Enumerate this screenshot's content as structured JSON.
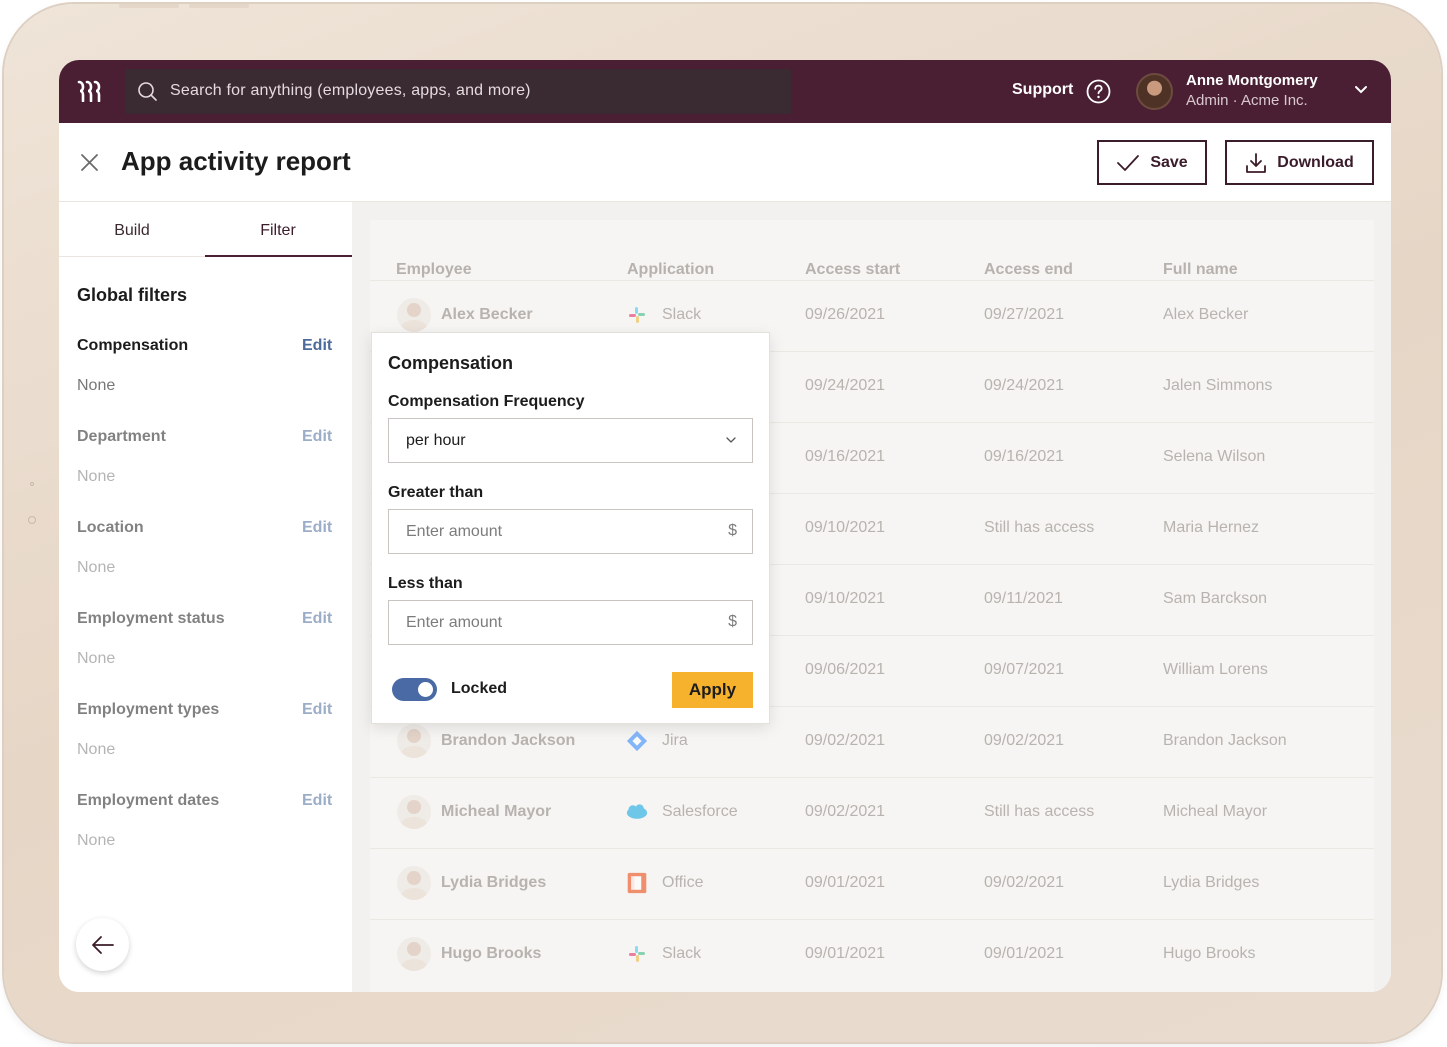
{
  "topbar": {
    "search_placeholder": "Search for anything (employees, apps, and more)",
    "support_label": "Support",
    "user_name": "Anne Montgomery",
    "user_role": "Admin · Acme Inc."
  },
  "header": {
    "title": "App activity report",
    "save_label": "Save",
    "download_label": "Download"
  },
  "sidebar": {
    "tabs": [
      {
        "label": "Build",
        "active": false
      },
      {
        "label": "Filter",
        "active": true
      }
    ],
    "section_title": "Global filters",
    "edit_label": "Edit",
    "filters": [
      {
        "label": "Compensation",
        "value": "None"
      },
      {
        "label": "Department",
        "value": "None"
      },
      {
        "label": "Location",
        "value": "None"
      },
      {
        "label": "Employment status",
        "value": "None"
      },
      {
        "label": "Employment types",
        "value": "None"
      },
      {
        "label": "Employment dates",
        "value": "None"
      }
    ]
  },
  "table": {
    "columns": [
      "Employee",
      "Application",
      "Access start",
      "Access end",
      "Full name"
    ],
    "rows": [
      {
        "employee": "Alex Becker",
        "app": "Slack",
        "icon": "slack-icon",
        "start": "09/26/2021",
        "end": "09/27/2021",
        "full": "Alex Becker"
      },
      {
        "employee": "",
        "app": "",
        "icon": "",
        "start": "09/24/2021",
        "end": "09/24/2021",
        "full": "Jalen Simmons"
      },
      {
        "employee": "",
        "app": "",
        "icon": "",
        "start": "09/16/2021",
        "end": "09/16/2021",
        "full": "Selena Wilson"
      },
      {
        "employee": "",
        "app": "",
        "icon": "",
        "start": "09/10/2021",
        "end": "Still has access",
        "full": "Maria Hernez"
      },
      {
        "employee": "",
        "app": "",
        "icon": "",
        "start": "09/10/2021",
        "end": "09/11/2021",
        "full": "Sam Barckson"
      },
      {
        "employee": "",
        "app": "",
        "icon": "",
        "start": "09/06/2021",
        "end": "09/07/2021",
        "full": "William Lorens"
      },
      {
        "employee": "Brandon Jackson",
        "app": "Jira",
        "icon": "jira-icon",
        "start": "09/02/2021",
        "end": "09/02/2021",
        "full": "Brandon Jackson"
      },
      {
        "employee": "Micheal Mayor",
        "app": "Salesforce",
        "icon": "salesforce-icon",
        "start": "09/02/2021",
        "end": "Still has access",
        "full": "Micheal Mayor"
      },
      {
        "employee": "Lydia Bridges",
        "app": "Office",
        "icon": "office-icon",
        "start": "09/01/2021",
        "end": "09/02/2021",
        "full": "Lydia Bridges"
      },
      {
        "employee": "Hugo Brooks",
        "app": "Slack",
        "icon": "slack-icon",
        "start": "09/01/2021",
        "end": "09/01/2021",
        "full": "Hugo Brooks"
      }
    ]
  },
  "popover": {
    "title": "Compensation",
    "frequency_label": "Compensation Frequency",
    "frequency_value": "per hour",
    "greater_label": "Greater than",
    "greater_placeholder": "Enter amount",
    "less_label": "Less than",
    "less_placeholder": "Enter amount",
    "currency_symbol": "$",
    "locked_label": "Locked",
    "locked_on": true,
    "apply_label": "Apply"
  },
  "colors": {
    "topbar": "#4a1f33",
    "accent_blue": "#4a6aa6",
    "apply_yellow": "#f7b22d"
  }
}
